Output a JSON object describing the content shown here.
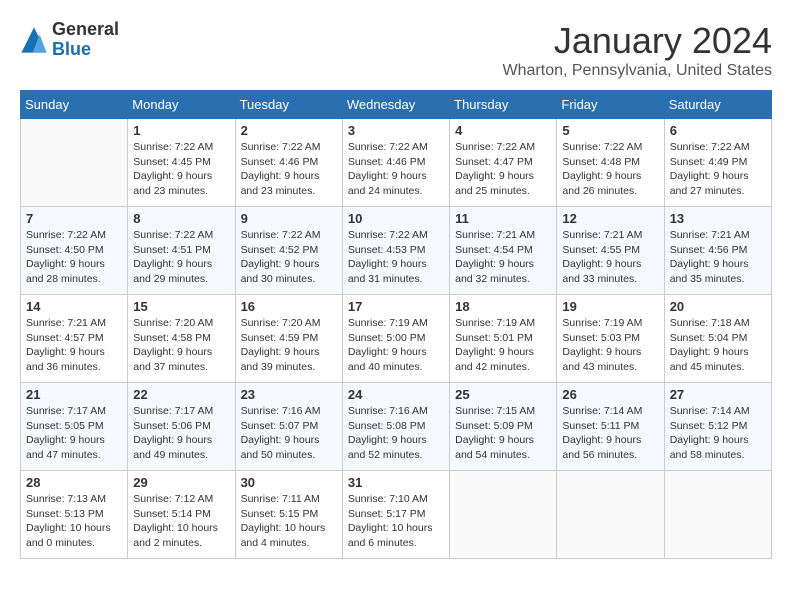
{
  "header": {
    "logo": {
      "general": "General",
      "blue": "Blue"
    },
    "title": "January 2024",
    "location": "Wharton, Pennsylvania, United States"
  },
  "calendar": {
    "days_of_week": [
      "Sunday",
      "Monday",
      "Tuesday",
      "Wednesday",
      "Thursday",
      "Friday",
      "Saturday"
    ],
    "weeks": [
      [
        {
          "day": "",
          "info": ""
        },
        {
          "day": "1",
          "info": "Sunrise: 7:22 AM\nSunset: 4:45 PM\nDaylight: 9 hours\nand 23 minutes."
        },
        {
          "day": "2",
          "info": "Sunrise: 7:22 AM\nSunset: 4:46 PM\nDaylight: 9 hours\nand 23 minutes."
        },
        {
          "day": "3",
          "info": "Sunrise: 7:22 AM\nSunset: 4:46 PM\nDaylight: 9 hours\nand 24 minutes."
        },
        {
          "day": "4",
          "info": "Sunrise: 7:22 AM\nSunset: 4:47 PM\nDaylight: 9 hours\nand 25 minutes."
        },
        {
          "day": "5",
          "info": "Sunrise: 7:22 AM\nSunset: 4:48 PM\nDaylight: 9 hours\nand 26 minutes."
        },
        {
          "day": "6",
          "info": "Sunrise: 7:22 AM\nSunset: 4:49 PM\nDaylight: 9 hours\nand 27 minutes."
        }
      ],
      [
        {
          "day": "7",
          "info": "Sunrise: 7:22 AM\nSunset: 4:50 PM\nDaylight: 9 hours\nand 28 minutes."
        },
        {
          "day": "8",
          "info": "Sunrise: 7:22 AM\nSunset: 4:51 PM\nDaylight: 9 hours\nand 29 minutes."
        },
        {
          "day": "9",
          "info": "Sunrise: 7:22 AM\nSunset: 4:52 PM\nDaylight: 9 hours\nand 30 minutes."
        },
        {
          "day": "10",
          "info": "Sunrise: 7:22 AM\nSunset: 4:53 PM\nDaylight: 9 hours\nand 31 minutes."
        },
        {
          "day": "11",
          "info": "Sunrise: 7:21 AM\nSunset: 4:54 PM\nDaylight: 9 hours\nand 32 minutes."
        },
        {
          "day": "12",
          "info": "Sunrise: 7:21 AM\nSunset: 4:55 PM\nDaylight: 9 hours\nand 33 minutes."
        },
        {
          "day": "13",
          "info": "Sunrise: 7:21 AM\nSunset: 4:56 PM\nDaylight: 9 hours\nand 35 minutes."
        }
      ],
      [
        {
          "day": "14",
          "info": "Sunrise: 7:21 AM\nSunset: 4:57 PM\nDaylight: 9 hours\nand 36 minutes."
        },
        {
          "day": "15",
          "info": "Sunrise: 7:20 AM\nSunset: 4:58 PM\nDaylight: 9 hours\nand 37 minutes."
        },
        {
          "day": "16",
          "info": "Sunrise: 7:20 AM\nSunset: 4:59 PM\nDaylight: 9 hours\nand 39 minutes."
        },
        {
          "day": "17",
          "info": "Sunrise: 7:19 AM\nSunset: 5:00 PM\nDaylight: 9 hours\nand 40 minutes."
        },
        {
          "day": "18",
          "info": "Sunrise: 7:19 AM\nSunset: 5:01 PM\nDaylight: 9 hours\nand 42 minutes."
        },
        {
          "day": "19",
          "info": "Sunrise: 7:19 AM\nSunset: 5:03 PM\nDaylight: 9 hours\nand 43 minutes."
        },
        {
          "day": "20",
          "info": "Sunrise: 7:18 AM\nSunset: 5:04 PM\nDaylight: 9 hours\nand 45 minutes."
        }
      ],
      [
        {
          "day": "21",
          "info": "Sunrise: 7:17 AM\nSunset: 5:05 PM\nDaylight: 9 hours\nand 47 minutes."
        },
        {
          "day": "22",
          "info": "Sunrise: 7:17 AM\nSunset: 5:06 PM\nDaylight: 9 hours\nand 49 minutes."
        },
        {
          "day": "23",
          "info": "Sunrise: 7:16 AM\nSunset: 5:07 PM\nDaylight: 9 hours\nand 50 minutes."
        },
        {
          "day": "24",
          "info": "Sunrise: 7:16 AM\nSunset: 5:08 PM\nDaylight: 9 hours\nand 52 minutes."
        },
        {
          "day": "25",
          "info": "Sunrise: 7:15 AM\nSunset: 5:09 PM\nDaylight: 9 hours\nand 54 minutes."
        },
        {
          "day": "26",
          "info": "Sunrise: 7:14 AM\nSunset: 5:11 PM\nDaylight: 9 hours\nand 56 minutes."
        },
        {
          "day": "27",
          "info": "Sunrise: 7:14 AM\nSunset: 5:12 PM\nDaylight: 9 hours\nand 58 minutes."
        }
      ],
      [
        {
          "day": "28",
          "info": "Sunrise: 7:13 AM\nSunset: 5:13 PM\nDaylight: 10 hours\nand 0 minutes."
        },
        {
          "day": "29",
          "info": "Sunrise: 7:12 AM\nSunset: 5:14 PM\nDaylight: 10 hours\nand 2 minutes."
        },
        {
          "day": "30",
          "info": "Sunrise: 7:11 AM\nSunset: 5:15 PM\nDaylight: 10 hours\nand 4 minutes."
        },
        {
          "day": "31",
          "info": "Sunrise: 7:10 AM\nSunset: 5:17 PM\nDaylight: 10 hours\nand 6 minutes."
        },
        {
          "day": "",
          "info": ""
        },
        {
          "day": "",
          "info": ""
        },
        {
          "day": "",
          "info": ""
        }
      ]
    ]
  }
}
